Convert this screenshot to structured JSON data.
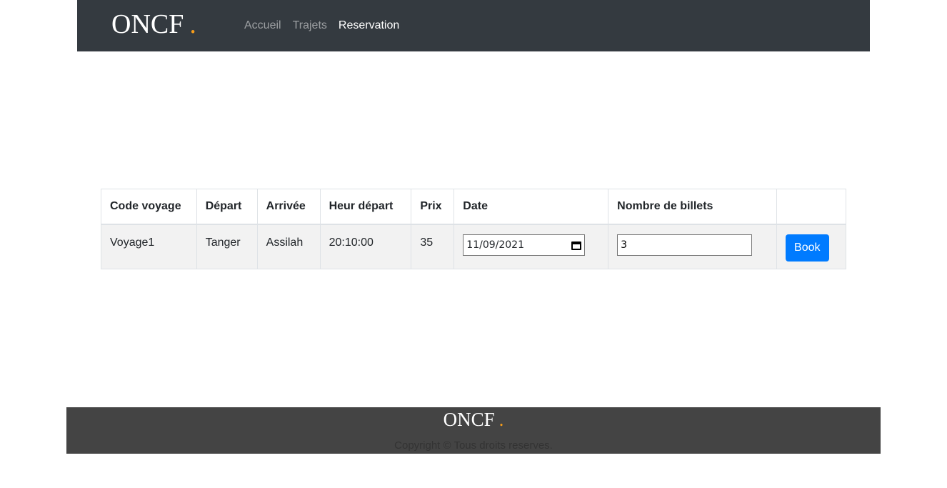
{
  "header": {
    "brand": "ONCF",
    "brand_dot": ".",
    "nav": [
      "Accueil",
      "Trajets",
      "Reservation"
    ]
  },
  "table": {
    "headers": [
      "Code voyage",
      "Départ",
      "Arrivée",
      "Heur départ",
      "Prix",
      "Date",
      "Nombre de billets",
      ""
    ],
    "row": {
      "code": "Voyage1",
      "depart": "Tanger",
      "arrivee": "Assilah",
      "heure": "20:10:00",
      "prix": "35",
      "date": "11/09/2021",
      "billets": "3",
      "book_label": "Book"
    }
  },
  "footer": {
    "brand": "ONCF",
    "brand_dot": ".",
    "copyright": "Copyright © Tous droits reserves."
  },
  "colors": {
    "navbar": "#343a40",
    "accent_dot": "#f59c1a",
    "button": "#007bff",
    "footer": "#444444"
  },
  "icons": {
    "date_picker": "calendar-icon"
  }
}
